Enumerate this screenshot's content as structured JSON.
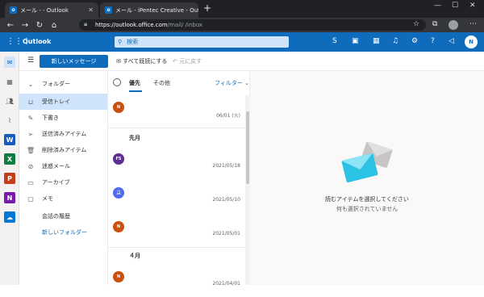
{
  "browser": {
    "tabs": [
      {
        "title": "メール -            - Outlook"
      },
      {
        "title": "メール - iPentec Creative - Outlook"
      }
    ],
    "url_host": "https://outlook.office.com",
    "url_path": "/mail/                          /inbox"
  },
  "app": {
    "brand": "Outlook",
    "search_placeholder": "検索",
    "user_initial": "N"
  },
  "toolbar": {
    "new_message": "新しいメッセージ",
    "mark_all_read": "すべて既読にする",
    "undo": "元に戻す"
  },
  "folders": {
    "header": "フォルダー",
    "items": [
      {
        "label": "受信トレイ",
        "icon": "inbox-icon"
      },
      {
        "label": "下書き",
        "icon": "pencil-icon"
      },
      {
        "label": "送信済みアイテム",
        "icon": "send-icon"
      },
      {
        "label": "削除済みアイテム",
        "icon": "trash-icon"
      },
      {
        "label": "迷惑メール",
        "icon": "blocked-icon"
      },
      {
        "label": "アーカイブ",
        "icon": "archive-icon"
      },
      {
        "label": "メモ",
        "icon": "note-icon"
      },
      {
        "label": "会話の履歴",
        "icon": ""
      },
      {
        "label": "新しいフォルダー",
        "icon": ""
      }
    ]
  },
  "messagelist": {
    "tab_focused": "優先",
    "tab_other": "その他",
    "filter": "フィルター",
    "groups": [
      "先月",
      "４月"
    ],
    "messages": [
      {
        "initials": "N",
        "color": "#ca5010",
        "date": "06/01 (火)"
      },
      {
        "initials": "FS",
        "color": "#5c2e91",
        "date": "2021/05/18"
      },
      {
        "initials": "",
        "color": "#4f6bed",
        "date": "2021/05/10"
      },
      {
        "initials": "N",
        "color": "#ca5010",
        "date": "2021/05/01"
      },
      {
        "initials": "N",
        "color": "#ca5010",
        "date": "2021/04/01"
      }
    ]
  },
  "reading": {
    "title": "読むアイテムを選択してください",
    "subtitle": "何も選択されていません"
  },
  "colors": {
    "accent": "#0f6cbd"
  }
}
